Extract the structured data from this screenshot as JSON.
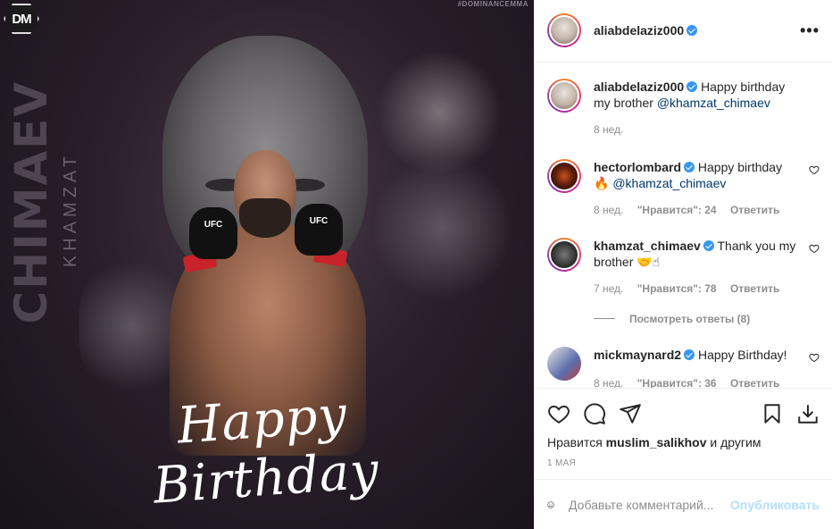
{
  "image": {
    "logo": "DM",
    "watermark": "#DOMINANCEMMA",
    "side_title": "CHIMAEV",
    "side_subtitle": "KHAMZAT",
    "glove_label": "UFC",
    "caption_script": "Happy Birthday"
  },
  "header": {
    "username": "aliabdelaziz000",
    "verified": true,
    "more_icon": "more-horizontal-icon"
  },
  "comments": [
    {
      "username": "aliabdelaziz000",
      "verified": true,
      "text": "Happy birthday my brother",
      "mention": "@khamzat_chimaev",
      "time": "8 нед.",
      "likes": "",
      "reply": "",
      "avatar": "av-ali"
    },
    {
      "username": "hectorlombard",
      "verified": true,
      "text": "Happy birthday",
      "emoji": "🔥",
      "mention": "@khamzat_chimaev",
      "time": "8 нед.",
      "likes": "\"Нравится\": 24",
      "reply": "Ответить",
      "avatar": "av-hector"
    },
    {
      "username": "khamzat_chimaev",
      "verified": true,
      "text": "Thank you my brother",
      "emoji": "🤝☝",
      "time": "7 нед.",
      "likes": "\"Нравится\": 78",
      "reply": "Ответить",
      "view_replies": "Посмотреть ответы (8)",
      "avatar": "av-khamzat"
    },
    {
      "username": "mickmaynard2",
      "verified": true,
      "text": "Happy Birthday!",
      "time": "8 нед.",
      "likes": "\"Нравится\": 36",
      "reply": "Ответить",
      "avatar": "av-mick"
    }
  ],
  "actions": {
    "liked_by_prefix": "Нравится",
    "liked_by_user": "muslim_salikhov",
    "liked_by_suffix": "и другим",
    "date": "1 МАЯ"
  },
  "add_comment": {
    "placeholder": "Добавьте комментарий...",
    "publish": "Опубликовать"
  },
  "colors": {
    "verified": "#3897f0",
    "publish_disabled": "#b2dffc",
    "mention": "#00376b"
  }
}
